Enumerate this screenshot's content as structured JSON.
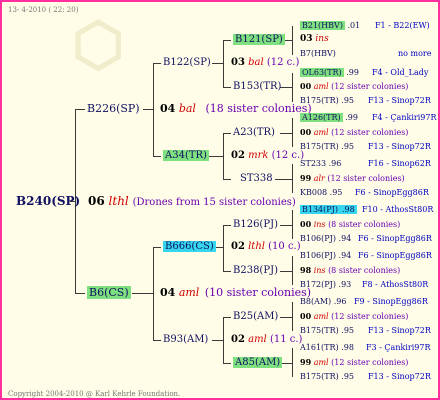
{
  "header": {
    "date": "13- 4-2010 ( 22: 20)"
  },
  "footer": {
    "copyright": "Copyright 2004-2010 @ Karl Kehrle Foundation."
  },
  "root": {
    "id": "B240(SP)",
    "num": "06",
    "name": "lthl",
    "note": "(Drones from 15 sister colonies)"
  },
  "gen1": {
    "upper": {
      "id": "B226(SP)",
      "num": "04",
      "name": "bal",
      "note": "(18 sister colonies)"
    },
    "lower": {
      "id": "B6(CS)",
      "num": "04",
      "name": "aml",
      "note": "(10 sister colonies)"
    }
  },
  "gen2": {
    "b122": {
      "id": "B122(SP)",
      "num": "03",
      "name": "bal",
      "note": "(12 c.)"
    },
    "a34": {
      "id": "A34(TR)",
      "num": "02",
      "name": "mrk",
      "note": "(12 c.)"
    },
    "b666": {
      "id": "B666(CS)",
      "num": "02",
      "name": "lthl",
      "note": "(10 c.)"
    },
    "b93": {
      "id": "B93(AM)",
      "num": "02",
      "name": "aml",
      "note": "(11 c.)"
    }
  },
  "gen3": {
    "b121": {
      "id": "B121(SP)"
    },
    "b153": {
      "id": "B153(TR)"
    },
    "a23": {
      "id": "A23(TR)"
    },
    "st338": {
      "id": "ST338"
    },
    "b126": {
      "id": "B126(PJ)"
    },
    "b238": {
      "id": "B238(PJ)"
    },
    "b25": {
      "id": "B25(AM)"
    },
    "a85": {
      "id": "A85(AM)"
    }
  },
  "gen4": [
    {
      "id": "B21(HBV)",
      "val": ".01",
      "ref": "F1 - B22(EW)"
    },
    {
      "num": "03",
      "name": "ins",
      "note": ""
    },
    {
      "id": "B7(HBV)",
      "val": "",
      "ref": "no more"
    },
    {
      "id": "OL63(TR)",
      "val": ".99",
      "ref": "F4 - Old_Lady"
    },
    {
      "num": "00",
      "name": "aml",
      "note": "(12 sister colonies)"
    },
    {
      "id": "B175(TR)",
      "val": ".95",
      "ref": "F13 - Sinop72R"
    },
    {
      "id": "A126(TR)",
      "val": ".99",
      "ref": "F4 - Çankiri97R"
    },
    {
      "num": "00",
      "name": "aml",
      "note": "(12 sister colonies)"
    },
    {
      "id": "B175(TR)",
      "val": ".95",
      "ref": "F13 - Sinop72R"
    },
    {
      "id": "ST233",
      "val": ".96",
      "ref": "F16 - Sinop62R"
    },
    {
      "num": "99",
      "name": "alr",
      "note": "(12 sister colonies)"
    },
    {
      "id": "KB008",
      "val": ".95",
      "ref": "F6 - SinopEgg86R"
    },
    {
      "id": "B134(PJ)",
      "val": ".98",
      "ref": "F10 - AthosSt80R"
    },
    {
      "num": "00",
      "name": "ins",
      "note": "(8 sister colonies)"
    },
    {
      "id": "B106(PJ)",
      "val": ".94",
      "ref": "F6 - SinopEgg86R"
    },
    {
      "id": "B106(PJ)",
      "val": ".94",
      "ref": "F6 - SinopEgg86R"
    },
    {
      "num": "98",
      "name": "ins",
      "note": "(8 sister colonies)"
    },
    {
      "id": "B172(PJ)",
      "val": ".93",
      "ref": "F8 - AthosSt80R"
    },
    {
      "id": "B8(AM)",
      "val": ".96",
      "ref": "F9 - SinopEgg86R"
    },
    {
      "num": "00",
      "name": "aml",
      "note": "(12 sister colonies)"
    },
    {
      "id": "B175(TR)",
      "val": ".95",
      "ref": "F13 - Sinop72R"
    },
    {
      "id": "A161(TR)",
      "val": ".98",
      "ref": "F3 - Çankiri97R"
    },
    {
      "num": "99",
      "name": "aml",
      "note": "(12 sister colonies)"
    },
    {
      "id": "B175(TR)",
      "val": ".95",
      "ref": "F13 - Sinop72R"
    }
  ]
}
